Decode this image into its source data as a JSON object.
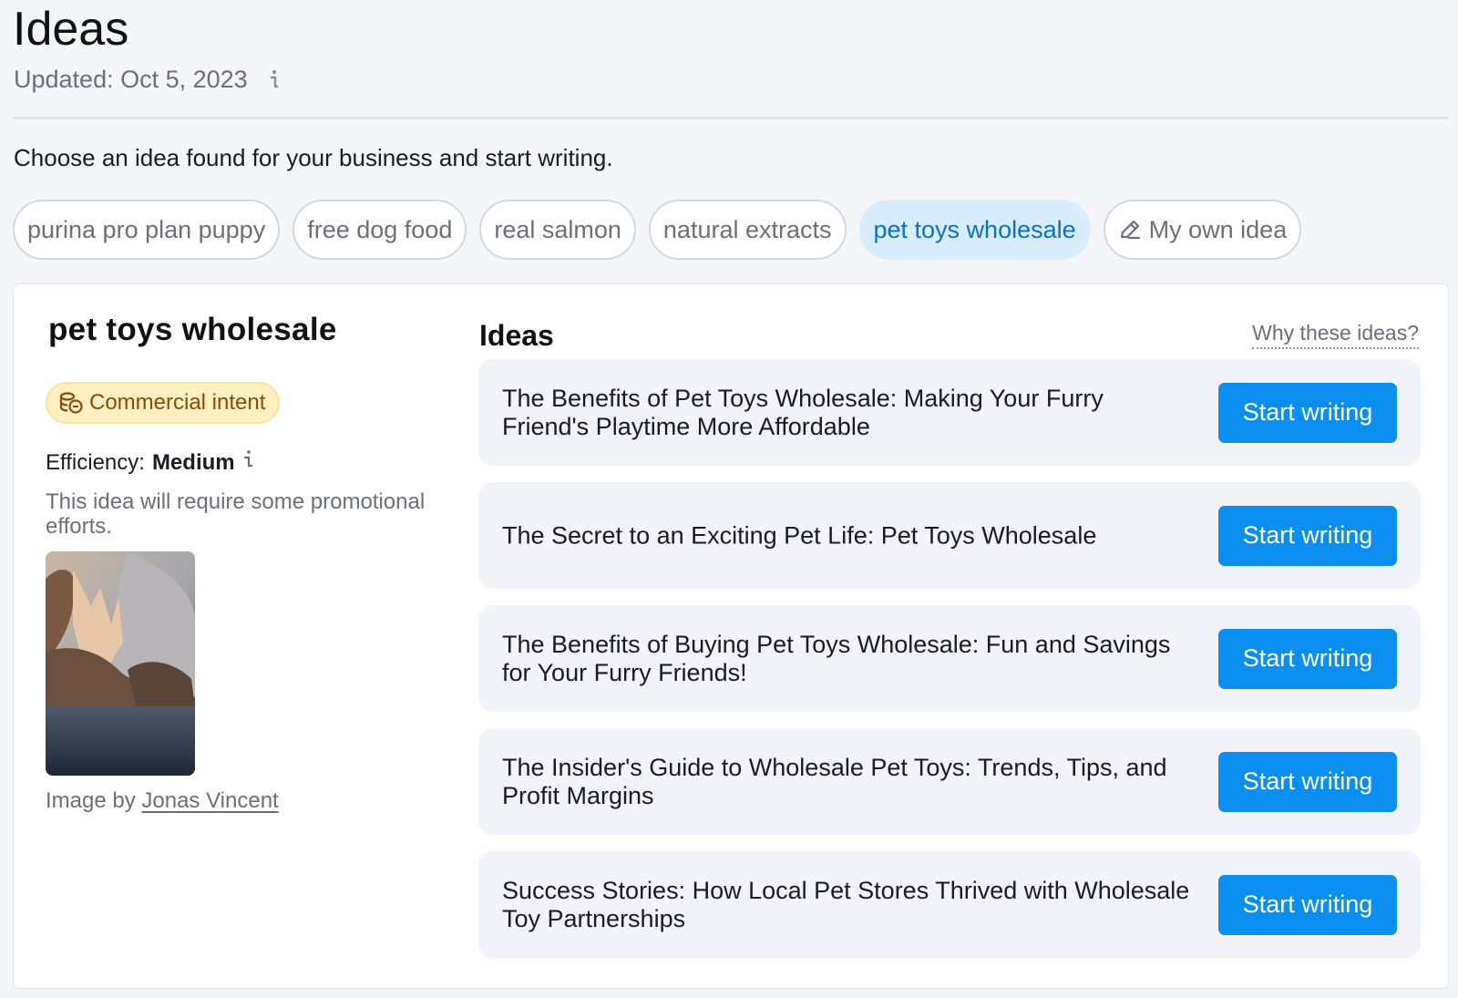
{
  "header": {
    "title": "Ideas",
    "updated": "Updated: Oct 5, 2023",
    "intro": "Choose an idea found for your business and start writing."
  },
  "chips": [
    {
      "label": "purina pro plan puppy",
      "active": false
    },
    {
      "label": "free dog food",
      "active": false
    },
    {
      "label": "real salmon",
      "active": false
    },
    {
      "label": "natural extracts",
      "active": false
    },
    {
      "label": "pet toys wholesale",
      "active": true
    },
    {
      "label": "My own idea",
      "icon": "pencil-icon",
      "active": false
    }
  ],
  "detail": {
    "keyword": "pet toys wholesale",
    "intent_label": "Commercial intent",
    "efficiency_label": "Efficiency:",
    "efficiency_value": "Medium",
    "efficiency_note": "This idea will require some promotional efforts.",
    "image_credit_prefix": "Image by",
    "image_credit_author": "Jonas Vincent"
  },
  "ideas": {
    "heading": "Ideas",
    "why_link": "Why these ideas?",
    "button_label": "Start writing",
    "items": [
      {
        "text": "The Benefits of Pet Toys Wholesale: Making Your Furry Friend's Playtime More Affordable"
      },
      {
        "text": "The Secret to an Exciting Pet Life: Pet Toys Wholesale"
      },
      {
        "text": "The Benefits of Buying Pet Toys Wholesale: Fun and Savings for Your Furry Friends!"
      },
      {
        "text": "The Insider's Guide to Wholesale Pet Toys: Trends, Tips, and Profit Margins"
      },
      {
        "text": "Success Stories: How Local Pet Stores Thrived with Wholesale Toy Partnerships"
      }
    ]
  },
  "colors": {
    "accent": "#0a8ef0",
    "chip_active_bg": "#d8ecfc",
    "intent_bg": "#fdefbf",
    "intent_text": "#8a4a0b"
  }
}
